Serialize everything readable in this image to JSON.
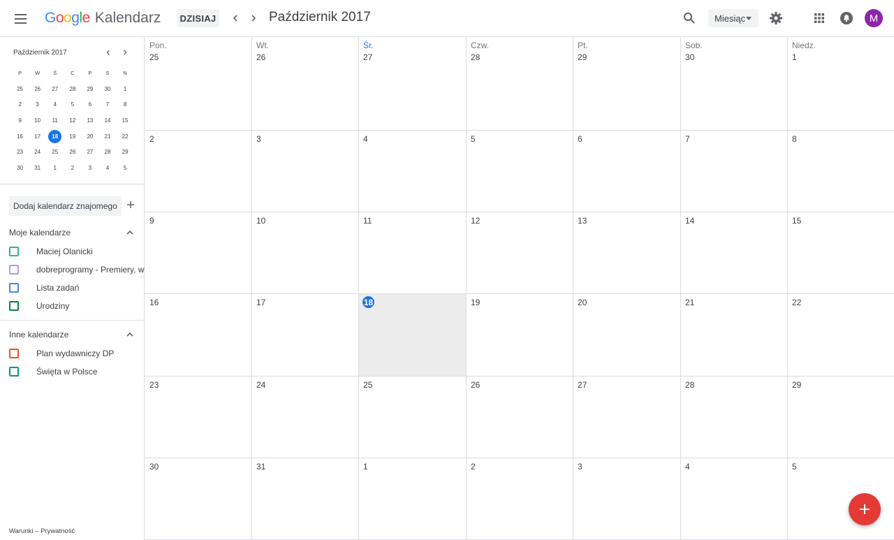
{
  "header": {
    "logo_google": "Google",
    "logo_product": "Kalendarz",
    "today_label": "DZISIAJ",
    "period_title": "Październik 2017",
    "view_label": "Miesiąc",
    "avatar_letter": "M",
    "icons": [
      "menu-icon",
      "chevron-left-icon",
      "chevron-right-icon",
      "search-icon",
      "settings-icon",
      "apps-icon",
      "notifications-icon"
    ]
  },
  "mini_calendar": {
    "title": "Październik 2017",
    "weekday_heads": [
      "P",
      "W",
      "Ś",
      "C",
      "P",
      "S",
      "N"
    ],
    "weeks": [
      [
        "25",
        "26",
        "27",
        "28",
        "29",
        "30",
        "1"
      ],
      [
        "2",
        "3",
        "4",
        "5",
        "6",
        "7",
        "8"
      ],
      [
        "9",
        "10",
        "11",
        "12",
        "13",
        "14",
        "15"
      ],
      [
        "16",
        "17",
        "18",
        "19",
        "20",
        "21",
        "22"
      ],
      [
        "23",
        "24",
        "25",
        "26",
        "27",
        "28",
        "29"
      ],
      [
        "30",
        "31",
        "1",
        "2",
        "3",
        "4",
        "5"
      ]
    ],
    "selected": "18"
  },
  "sidebar": {
    "add_friend_placeholder": "Dodaj kalendarz znajomego",
    "my_calendars_title": "Moje kalendarze",
    "my_calendars": [
      {
        "label": "Maciej Olanicki",
        "color": "#33b679"
      },
      {
        "label": "dobreprogramy - Premiery, wydarzenia",
        "color": "#b39ddb"
      },
      {
        "label": "Lista zadań",
        "color": "#4285f4"
      },
      {
        "label": "Urodziny",
        "color": "#0b8043"
      }
    ],
    "other_calendars_title": "Inne kalendarze",
    "other_calendars": [
      {
        "label": "Plan wydawniczy DP",
        "color": "#f4511e"
      },
      {
        "label": "Święta w Polsce",
        "color": "#009688"
      }
    ],
    "footer_terms": "Warunki",
    "footer_sep": " – ",
    "footer_privacy": "Prywatność"
  },
  "month": {
    "weekdays": [
      "Pon.",
      "Wt.",
      "Śr.",
      "Czw.",
      "Pt.",
      "Sob.",
      "Niedz."
    ],
    "weeks": [
      [
        "25",
        "26",
        "27",
        "28",
        "29",
        "30",
        "1"
      ],
      [
        "2",
        "3",
        "4",
        "5",
        "6",
        "7",
        "8"
      ],
      [
        "9",
        "10",
        "11",
        "12",
        "13",
        "14",
        "15"
      ],
      [
        "16",
        "17",
        "18",
        "19",
        "20",
        "21",
        "22"
      ],
      [
        "23",
        "24",
        "25",
        "26",
        "27",
        "28",
        "29"
      ],
      [
        "30",
        "31",
        "1",
        "2",
        "3",
        "4",
        "5"
      ]
    ],
    "today_col": 2,
    "today_week": 3
  },
  "colors": {
    "accent": "#1a73e8",
    "fab": "#e53935"
  }
}
